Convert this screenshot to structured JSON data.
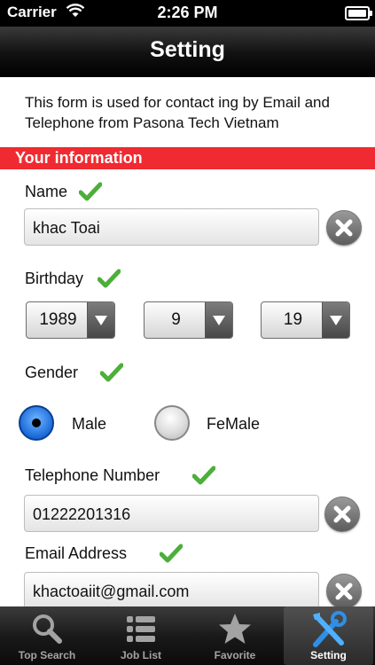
{
  "status": {
    "carrier": "Carrier",
    "time": "2:26 PM"
  },
  "nav": {
    "title": "Setting"
  },
  "intro": "This form is used for  contact ing  by  Email and Telephone  from Pasona Tech Vietnam",
  "section_title": "Your  information",
  "name": {
    "label": "Name",
    "value": "khac Toai"
  },
  "birthday": {
    "label": "Birthday",
    "year": "1989",
    "month": "9",
    "day": "19"
  },
  "gender": {
    "label": "Gender",
    "male": "Male",
    "female": "FeMale",
    "selected": "Male"
  },
  "telephone": {
    "label": "Telephone Number",
    "value": "01222201316"
  },
  "email": {
    "label": "Email Address",
    "value": "khactoaiit@gmail.com"
  },
  "tabs": [
    {
      "label": "Top Search",
      "icon": "search-icon"
    },
    {
      "label": "Job List",
      "icon": "list-icon"
    },
    {
      "label": "Favorite",
      "icon": "star-icon"
    },
    {
      "label": "Setting",
      "icon": "tools-icon"
    }
  ],
  "colors": {
    "section_bg": "#f02a31",
    "check": "#4caf3a",
    "radio_selected": "#1a69d9"
  }
}
